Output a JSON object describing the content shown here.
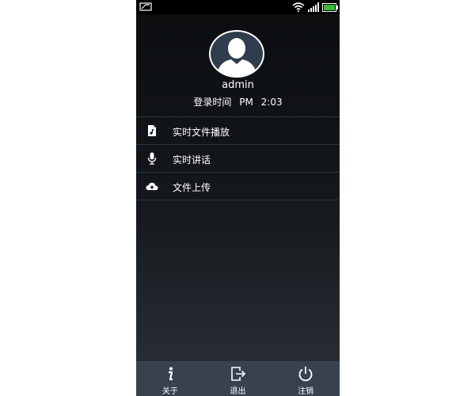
{
  "profile": {
    "username": "admin",
    "login_label": "登录时间",
    "login_ampm": "PM",
    "login_time": "2:03"
  },
  "menu": [
    {
      "icon": "file-music-icon",
      "label": "实时文件播放"
    },
    {
      "icon": "microphone-icon",
      "label": "实时讲话"
    },
    {
      "icon": "cloud-upload-icon",
      "label": "文件上传"
    }
  ],
  "bottom_bar": [
    {
      "icon": "info-icon",
      "label": "关于"
    },
    {
      "icon": "exit-icon",
      "label": "退出"
    },
    {
      "icon": "power-icon",
      "label": "注销"
    }
  ]
}
